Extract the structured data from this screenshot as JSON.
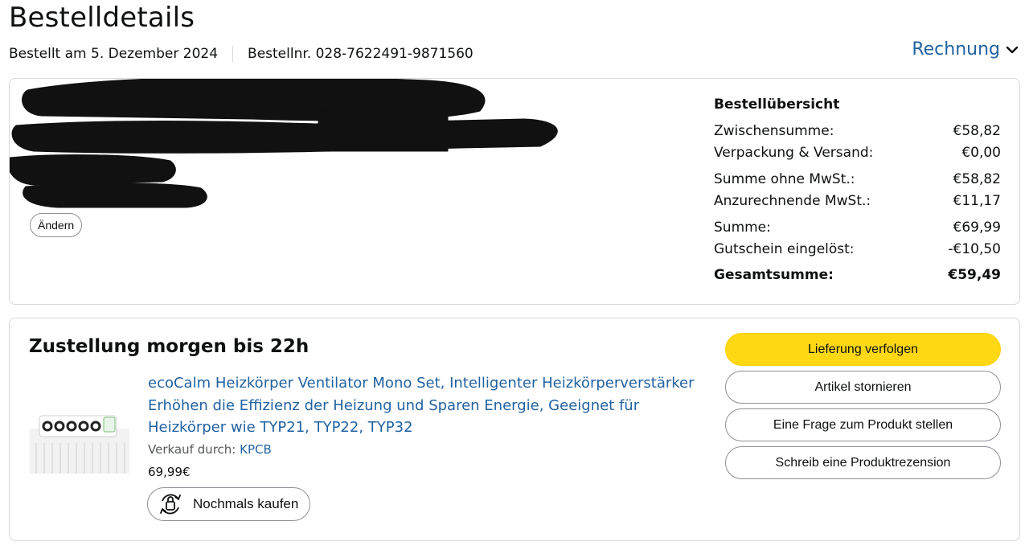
{
  "page": {
    "title": "Bestelldetails"
  },
  "order_meta": {
    "date": "Bestellt am 5. Dezember 2024",
    "number": "Bestellnr. 028-7622491-9871560"
  },
  "invoice": {
    "label": "Rechnung"
  },
  "address": {
    "change_label": "Ändern"
  },
  "summary": {
    "title": "Bestellübersicht",
    "rows": [
      {
        "label": "Zwischensumme:",
        "value": "€58,82"
      },
      {
        "label": "Verpackung & Versand:",
        "value": "€0,00"
      },
      {
        "label": "Summe ohne MwSt.:",
        "value": "€58,82"
      },
      {
        "label": "Anzurechnende MwSt.:",
        "value": "€11,17"
      },
      {
        "label": "Summe:",
        "value": "€69,99"
      },
      {
        "label": "Gutschein eingelöst:",
        "value": "-€10,50"
      }
    ],
    "total": {
      "label": "Gesamtsumme:",
      "value": "€59,49"
    }
  },
  "delivery": {
    "title": "Zustellung morgen bis 22h",
    "product": {
      "title": "ecoCalm Heizkörper Ventilator Mono Set, Intelligenter Heizkörperverstärker Erhöhen die Effizienz der Heizung und Sparen Energie, Geeignet für Heizkörper wie TYP21, TYP22, TYP32",
      "seller_prefix": "Verkauf durch:",
      "seller_name": "KPCB",
      "price": "69,99€",
      "buy_again_label": "Nochmals kaufen"
    },
    "actions": {
      "track": "Lieferung verfolgen",
      "cancel": "Artikel stornieren",
      "question": "Eine Frage zum Produkt stellen",
      "review": "Schreib eine Produktrezension"
    }
  },
  "colors": {
    "link": "#2162a1",
    "primary_button": "#ffd814",
    "border": "#d5d9d9"
  }
}
